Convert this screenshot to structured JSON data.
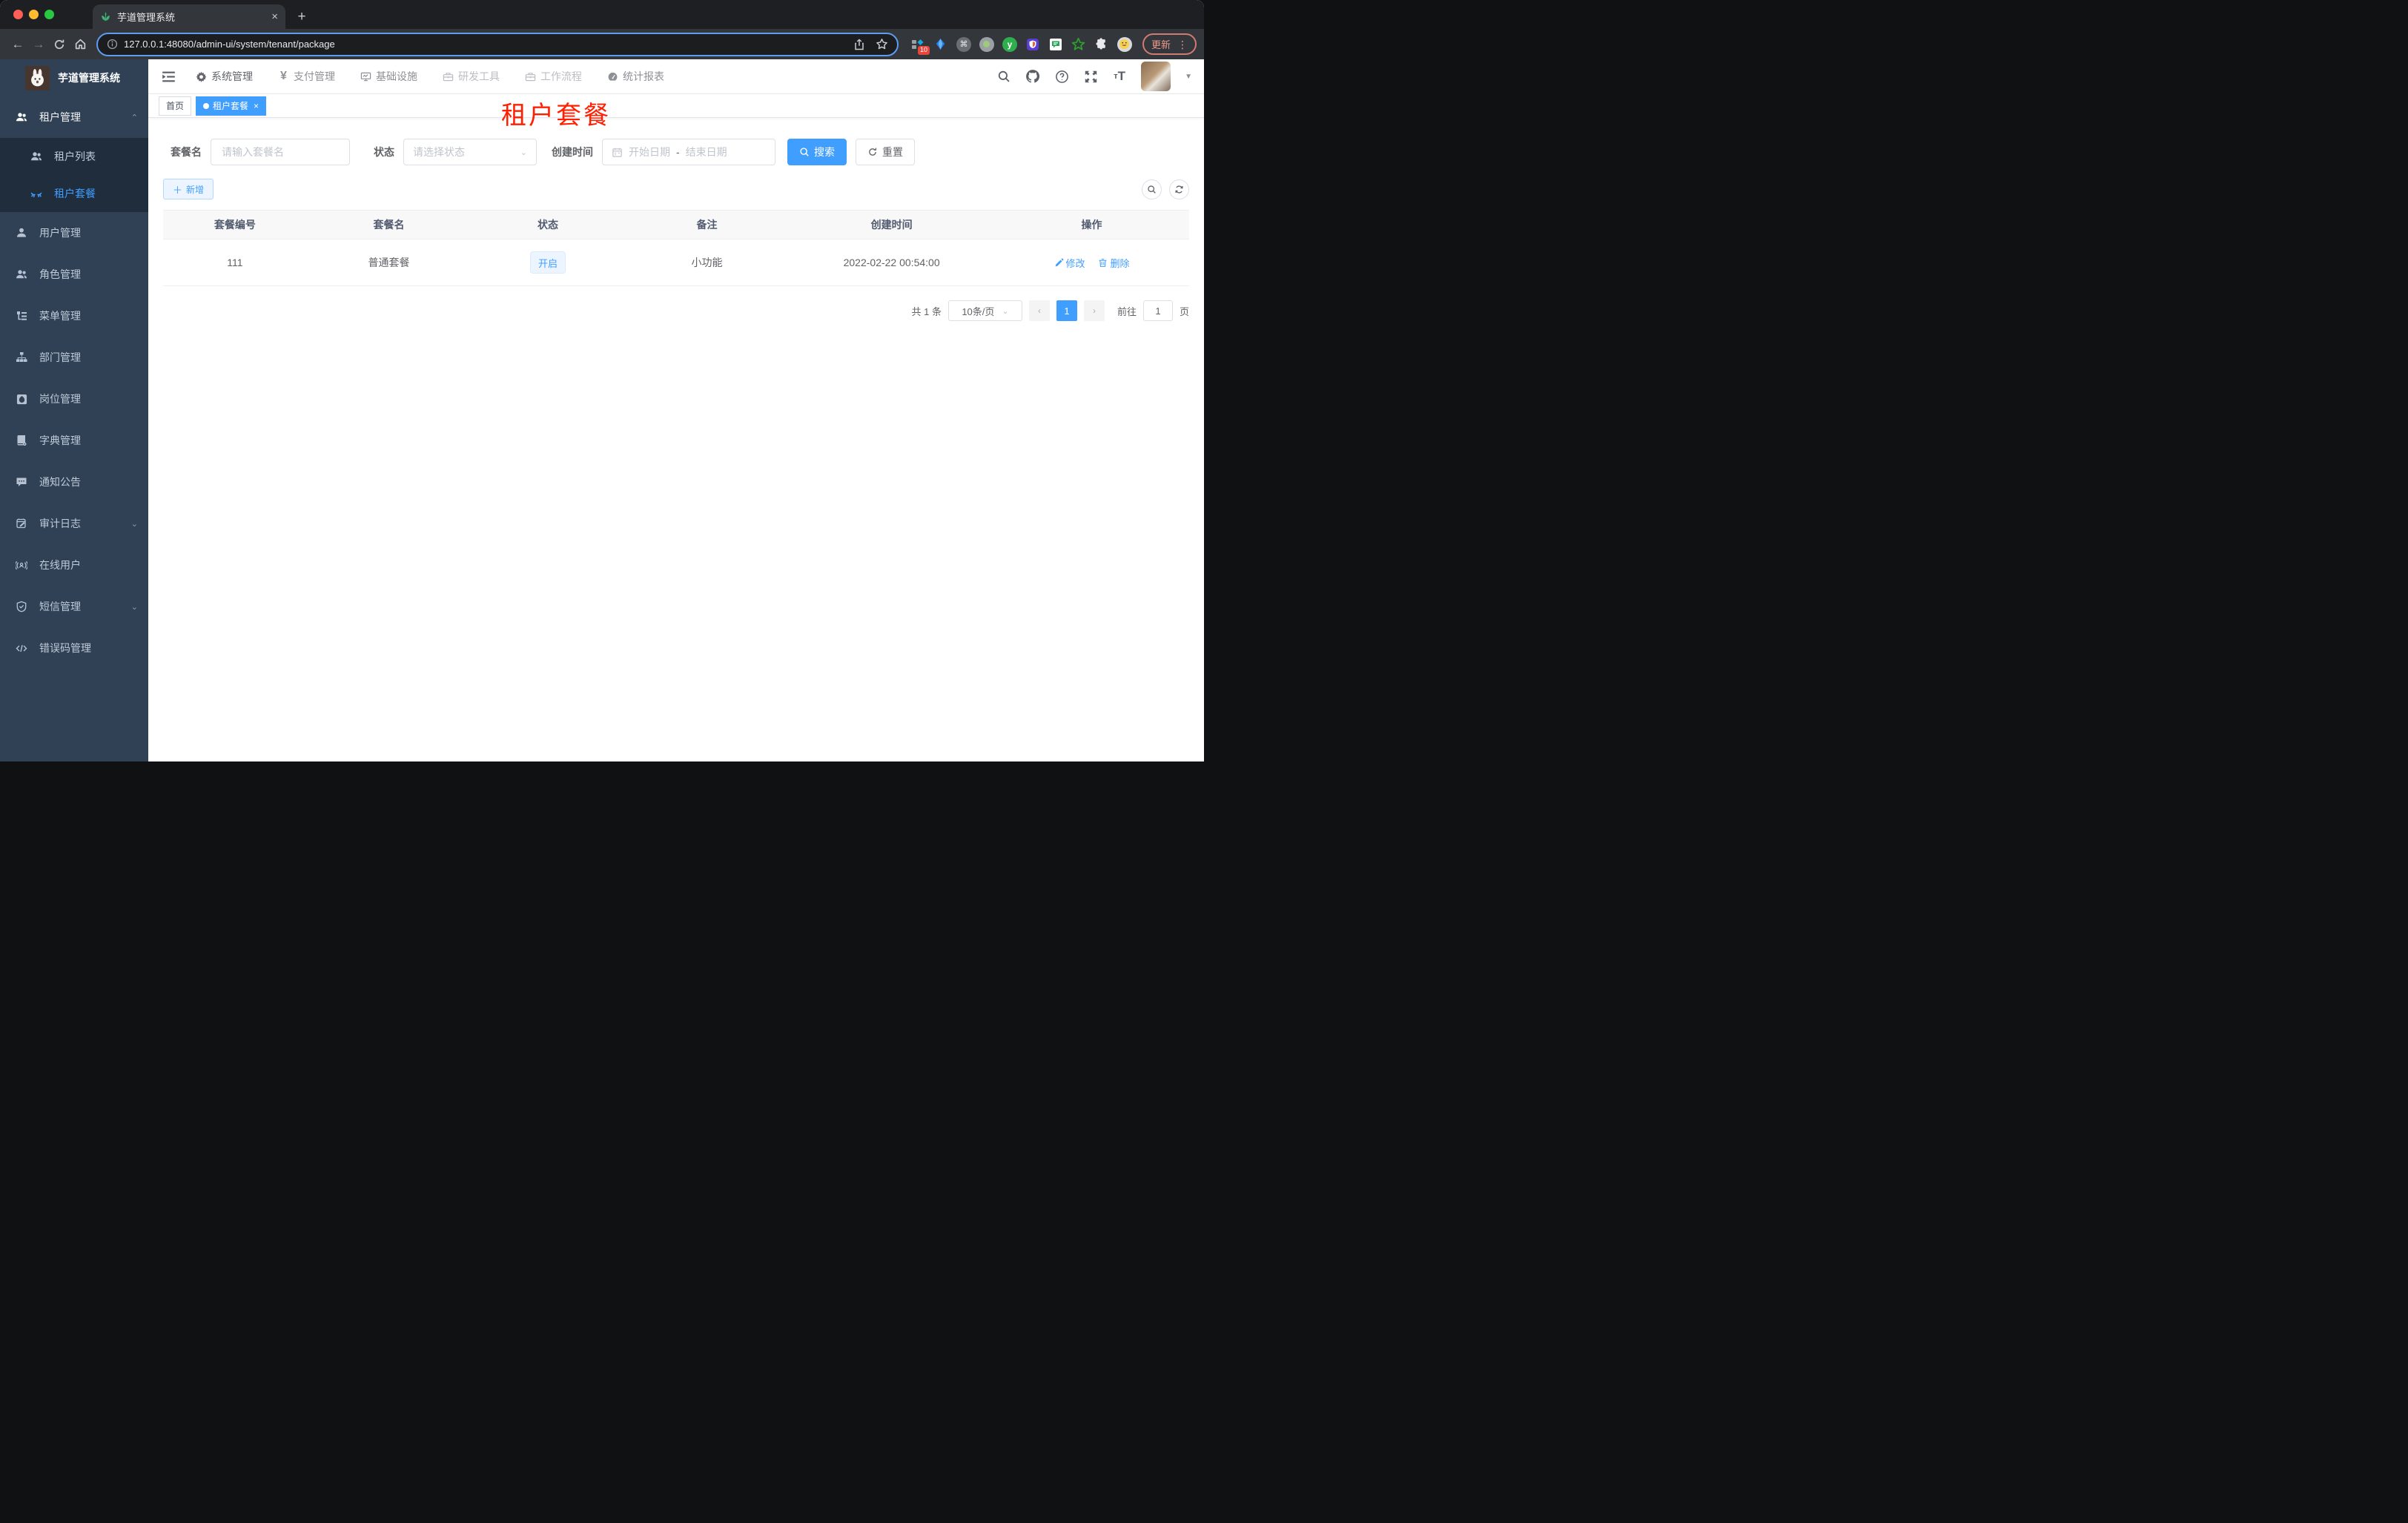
{
  "colors": {
    "accent": "#409eff",
    "annotation_red": "#ff1e00",
    "sidebar_bg": "#304156",
    "submenu_bg": "#1f2d3d"
  },
  "browser": {
    "tab_title": "芋道管理系统",
    "tab_close": "×",
    "new_tab": "+",
    "url": "127.0.0.1:48080/admin-ui/system/tenant/package",
    "extension_badge": "10",
    "update_label": "更新",
    "menu_dots": "⋮"
  },
  "sidebar": {
    "app_title": "芋道管理系统",
    "menu": [
      {
        "label": "租户管理",
        "icon": "peoples-icon",
        "expanded": true,
        "children": [
          {
            "label": "租户列表",
            "icon": "tenant-list-icon"
          },
          {
            "label": "租户套餐",
            "icon": "tenant-package-icon",
            "active": true
          }
        ]
      },
      {
        "label": "用户管理",
        "icon": "user-icon"
      },
      {
        "label": "角色管理",
        "icon": "peoples-icon"
      },
      {
        "label": "菜单管理",
        "icon": "tree-table-icon"
      },
      {
        "label": "部门管理",
        "icon": "tree-icon"
      },
      {
        "label": "岗位管理",
        "icon": "post-icon"
      },
      {
        "label": "字典管理",
        "icon": "dict-icon"
      },
      {
        "label": "通知公告",
        "icon": "message-icon"
      },
      {
        "label": "审计日志",
        "icon": "log-icon",
        "collapsible": true
      },
      {
        "label": "在线用户",
        "icon": "online-icon"
      },
      {
        "label": "短信管理",
        "icon": "sms-icon",
        "collapsible": true
      },
      {
        "label": "错误码管理",
        "icon": "code-icon"
      }
    ]
  },
  "topnav": {
    "items": [
      {
        "label": "系统管理",
        "icon": "gear-icon"
      },
      {
        "label": "支付管理",
        "icon": "yen-icon"
      },
      {
        "label": "基础设施",
        "icon": "monitor-icon"
      },
      {
        "label": "研发工具",
        "icon": "toolbox-icon"
      },
      {
        "label": "工作流程",
        "icon": "workflow-icon"
      },
      {
        "label": "统计报表",
        "icon": "dashboard-icon"
      }
    ]
  },
  "tags": {
    "home": "首页",
    "active": "租户套餐",
    "close": "×"
  },
  "annotation": {
    "text": "租户套餐"
  },
  "filters": {
    "name_label": "套餐名",
    "name_placeholder": "请输入套餐名",
    "status_label": "状态",
    "status_placeholder": "请选择状态",
    "date_label": "创建时间",
    "date_start_placeholder": "开始日期",
    "date_separator": "-",
    "date_end_placeholder": "结束日期",
    "search_label": "搜索",
    "reset_label": "重置"
  },
  "toolbar": {
    "add_label": "新增"
  },
  "table": {
    "columns": [
      "套餐编号",
      "套餐名",
      "状态",
      "备注",
      "创建时间",
      "操作"
    ],
    "row": {
      "id": "111",
      "name": "普通套餐",
      "status": "开启",
      "remark": "小功能",
      "created_at": "2022-02-22 00:54:00",
      "edit_label": "修改",
      "delete_label": "删除"
    }
  },
  "pagination": {
    "total": "共 1 条",
    "page_size": "10条/页",
    "prev": "‹",
    "next": "›",
    "current_page": "1",
    "goto_label": "前往",
    "goto_value": "1",
    "page_unit": "页"
  }
}
